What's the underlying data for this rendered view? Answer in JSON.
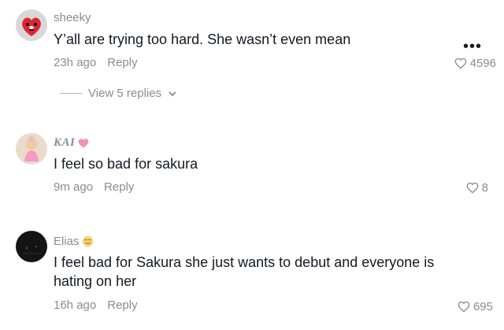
{
  "comments": [
    {
      "username": "sheeky",
      "text": "Y’all are trying too hard. She wasn’t even mean",
      "time": "23h ago",
      "reply_label": "Reply",
      "likes": "4596",
      "view_replies": "View 5 replies",
      "avatar_icon": "red-heart-character-avatar"
    },
    {
      "username": "KAI",
      "text": "I feel so bad for sakura",
      "time": "9m ago",
      "reply_label": "Reply",
      "likes": "8",
      "badge_icon": "pink-heart-emoji",
      "avatar_icon": "baby-photo-avatar"
    },
    {
      "username": "Elias",
      "text": "I feel bad for Sakura she just wants to debut and everyone is hating on her",
      "time": "16h ago",
      "reply_label": "Reply",
      "likes": "695",
      "badge_icon": "smiling-face-emoji",
      "avatar_icon": "dark-avatar"
    }
  ],
  "more_label": "•••",
  "colors": {
    "text": "#161823",
    "muted": "#8a8b91"
  }
}
